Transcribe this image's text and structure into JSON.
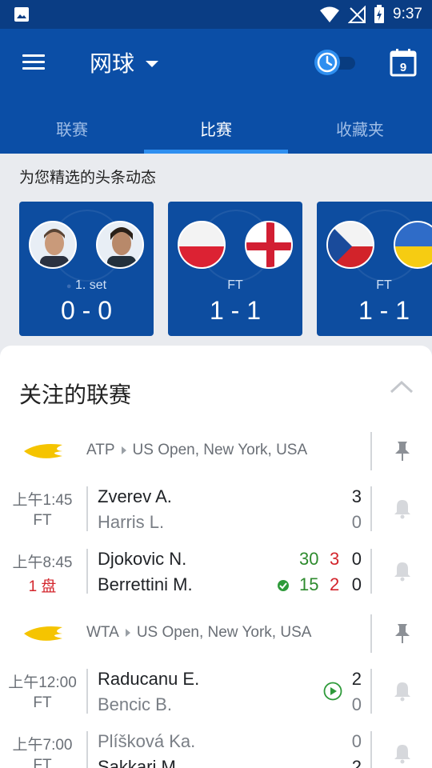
{
  "statusbar": {
    "time": "9:37"
  },
  "appbar": {
    "sport": "网球",
    "calendar_day": "9",
    "tabs": [
      {
        "label": "联赛",
        "active": false
      },
      {
        "label": "比赛",
        "active": true
      },
      {
        "label": "收藏夹",
        "active": false
      }
    ]
  },
  "featured": {
    "title": "为您精选的头条动态",
    "cards": [
      {
        "status": "1. set",
        "score": "0 - 0"
      },
      {
        "status": "FT",
        "score": "1 - 1"
      },
      {
        "status": "FT",
        "score": "1 - 1"
      }
    ]
  },
  "followed": {
    "title": "关注的联赛",
    "leagues": [
      {
        "tour": "ATP",
        "event": "US Open, New York, USA",
        "matches": [
          {
            "time": "上午1:45",
            "status": "FT",
            "p1": "Zverev A.",
            "p2": "Harris L.",
            "s1": "3",
            "s2": "0"
          },
          {
            "time": "上午8:45",
            "status": "1 盘",
            "p1": "Djokovic N.",
            "p2": "Berrettini M.",
            "g1": "30",
            "set1": "3",
            "s1": "0",
            "g2": "15",
            "set2": "2",
            "s2": "0"
          }
        ]
      },
      {
        "tour": "WTA",
        "event": "US Open, New York, USA",
        "matches": [
          {
            "time": "上午12:00",
            "status": "FT",
            "p1": "Raducanu E.",
            "p2": "Bencic B.",
            "s1": "2",
            "s2": "0"
          },
          {
            "time": "上午7:00",
            "status": "FT",
            "p1": "Plíšková Ka.",
            "p2": "Sakkari M.",
            "s1": "0",
            "s2": "2"
          }
        ]
      }
    ]
  },
  "colors": {
    "header": "#0b4ea6",
    "accent": "#2f8ff0",
    "live": "#d3252c",
    "green": "#2e8b2e"
  }
}
